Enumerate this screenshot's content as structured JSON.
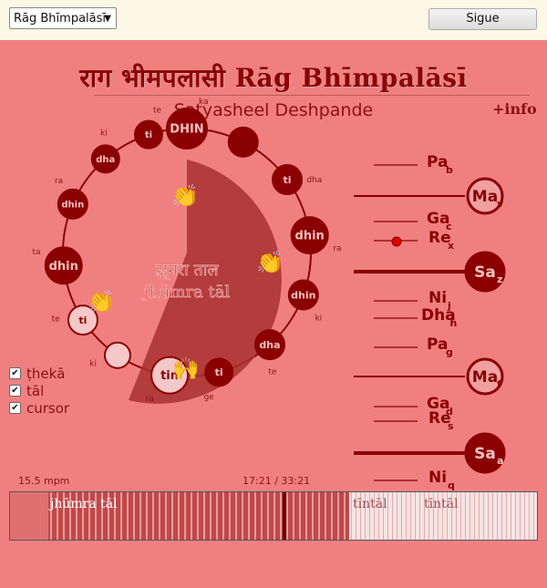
{
  "header": {
    "raga_select": "Rāg Bhīmpalāsī",
    "next_button": "Sigue"
  },
  "title": "राग भीमपलासी Rāg Bhīmpalāsī",
  "artist": "Satyasheel Deshpande",
  "info_link": "+info",
  "tal": {
    "name_deva": "झूमरा ताल",
    "name_latin": "jhūmra tāl",
    "beats": [
      {
        "bol": "DHIN",
        "sub": "ka"
      },
      {
        "bol": "",
        "sub": ""
      },
      {
        "bol": "ti",
        "sub": "dha"
      },
      {
        "bol": "dhin",
        "sub": "ra"
      },
      {
        "bol": "dhin",
        "sub": "ki"
      },
      {
        "bol": "dha",
        "sub": "te"
      },
      {
        "bol": "ti",
        "sub": "ge"
      },
      {
        "bol": "tin",
        "sub": "ra"
      },
      {
        "bol": "",
        "sub": "ki"
      },
      {
        "bol": "ti",
        "sub": "te"
      },
      {
        "bol": "dhin",
        "sub": "ta"
      },
      {
        "bol": "dhin",
        "sub": "ra"
      },
      {
        "bol": "dha",
        "sub": "ki"
      },
      {
        "bol": "ti",
        "sub": "te"
      }
    ],
    "extra_syllables": [
      "ka",
      "ki",
      "te",
      "ge",
      "ra",
      "ki",
      "te",
      "ta",
      "ra",
      "ki",
      "ge",
      "ra",
      "ki",
      "te"
    ]
  },
  "toggles": [
    {
      "label": "ṭhekā",
      "checked": true
    },
    {
      "label": "tāl",
      "checked": true
    },
    {
      "label": "cursor",
      "checked": true
    }
  ],
  "notes": [
    {
      "name": "Pa",
      "sub": "b",
      "active": false
    },
    {
      "name": "Ma",
      "sub": "v",
      "active": true
    },
    {
      "name": "Ga",
      "sub": "c",
      "active": false
    },
    {
      "name": "Re",
      "sub": "x",
      "active": false
    },
    {
      "name": "Sa",
      "sub": "z",
      "active": true
    },
    {
      "name": "Ni",
      "sub": "j",
      "active": false
    },
    {
      "name": "Dha",
      "sub": "h",
      "active": false
    },
    {
      "name": "Pa",
      "sub": "g",
      "active": false
    },
    {
      "name": "Ma",
      "sub": "f",
      "active": true
    },
    {
      "name": "Ga",
      "sub": "d",
      "active": false
    },
    {
      "name": "Re",
      "sub": "s",
      "active": false
    },
    {
      "name": "Sa",
      "sub": "a",
      "active": true
    },
    {
      "name": "Ni",
      "sub": "q",
      "active": false
    }
  ],
  "tempo": "15.5 mpm",
  "position": "17:21 / 33:21",
  "timeline": {
    "segments": [
      "jhūmra tāl",
      "tīntāl",
      "tīntāl"
    ]
  },
  "colors": {
    "background": "#f08080",
    "dark": "#8b0000",
    "page": "#fdf8e6"
  }
}
